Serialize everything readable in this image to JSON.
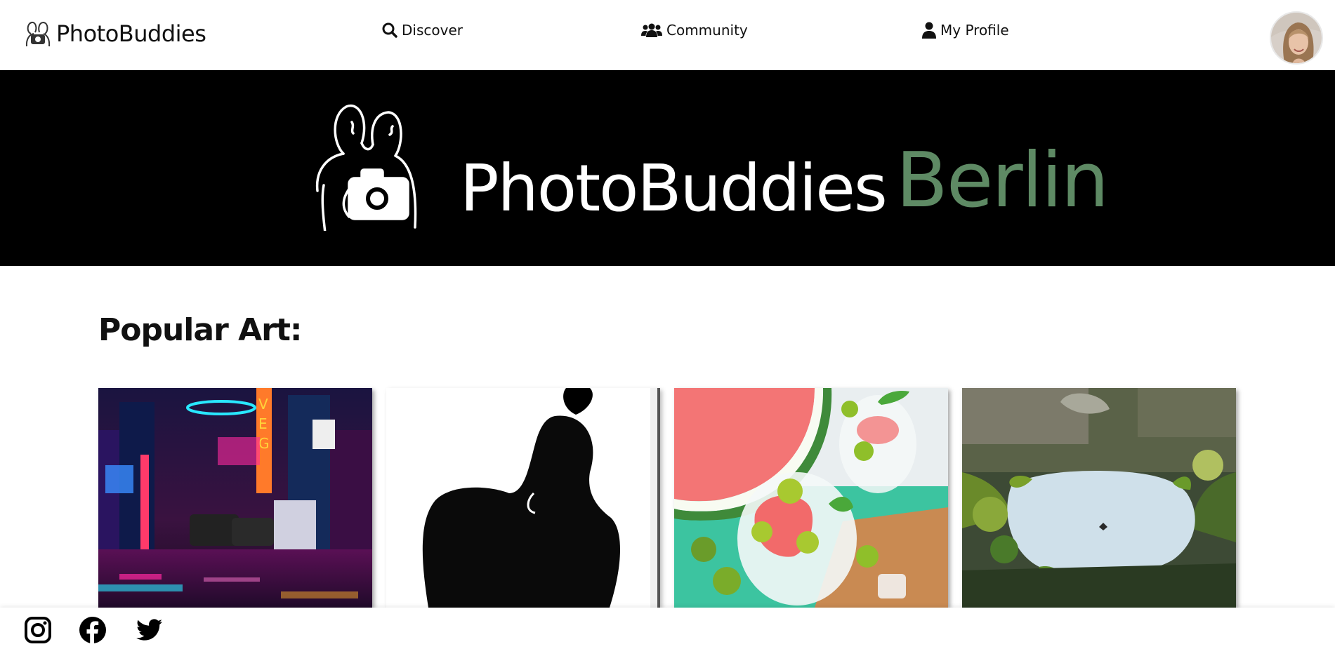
{
  "header": {
    "brand": "PhotoBuddies",
    "nav": [
      {
        "label": "Discover",
        "icon": "search-icon"
      },
      {
        "label": "Community",
        "icon": "users-icon"
      },
      {
        "label": "My Profile",
        "icon": "user-icon"
      }
    ],
    "avatar_icon": "avatar"
  },
  "banner": {
    "title": "PhotoBuddies",
    "city": "Berlin",
    "accent_color": "#5e8a64"
  },
  "main": {
    "section_title": "Popular Art:",
    "gallery": [
      {
        "icon": "neon-street-photo"
      },
      {
        "icon": "silhouette-photo"
      },
      {
        "icon": "watermelon-drink-photo"
      },
      {
        "icon": "canopy-sky-photo"
      }
    ]
  },
  "footer": {
    "social": [
      "instagram-icon",
      "facebook-icon",
      "twitter-icon"
    ]
  }
}
